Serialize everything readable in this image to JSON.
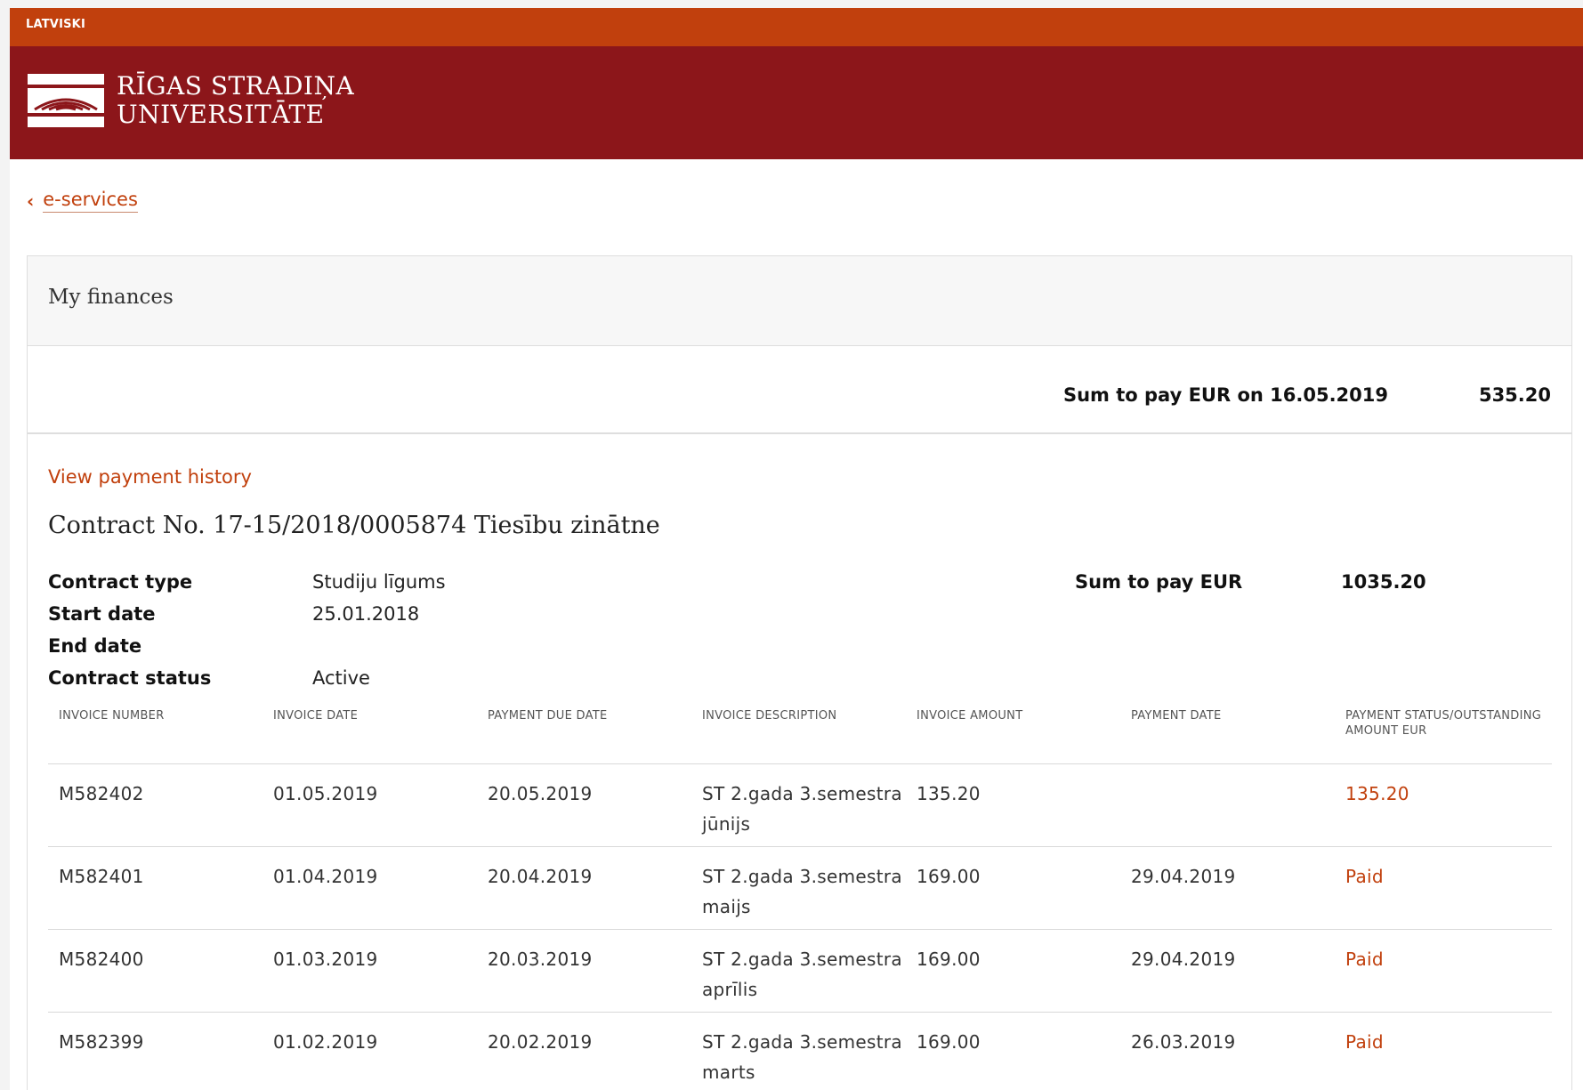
{
  "topbar": {
    "language_link": "LATVISKI"
  },
  "brand": {
    "line1": "RĪGAS STRADIŅA",
    "line2": "UNIVERSITĀTE",
    "accent_color": "#c1400d",
    "brand_color": "#8c161a"
  },
  "breadcrumb": {
    "back_label": "e-services"
  },
  "finances": {
    "title": "My finances",
    "sum_label": "Sum to pay EUR on 16.05.2019",
    "sum_value": "535.20",
    "history_link": "View payment history"
  },
  "contract": {
    "title": "Contract No. 17-15/2018/0005874 Tiesību zinātne",
    "fields": [
      {
        "label": "Contract type",
        "value": "Studiju līgums"
      },
      {
        "label": "Start date",
        "value": "25.01.2018"
      },
      {
        "label": "End date",
        "value": ""
      },
      {
        "label": "Contract status",
        "value": "Active"
      }
    ],
    "sum_label": "Sum to pay EUR",
    "sum_value": "1035.20"
  },
  "invoices": {
    "headers": [
      "INVOICE NUMBER",
      "INVOICE DATE",
      "PAYMENT DUE DATE",
      "INVOICE DESCRIPTION",
      "INVOICE AMOUNT",
      "PAYMENT DATE",
      "PAYMENT STATUS/OUTSTANDING AMOUNT EUR"
    ],
    "rows": [
      [
        "M582402",
        "01.05.2019",
        "20.05.2019",
        "ST 2.gada 3.semestra jūnijs",
        "135.20",
        "",
        "135.20"
      ],
      [
        "M582401",
        "01.04.2019",
        "20.04.2019",
        "ST 2.gada 3.semestra maijs",
        "169.00",
        "29.04.2019",
        "Paid"
      ],
      [
        "M582400",
        "01.03.2019",
        "20.03.2019",
        "ST 2.gada 3.semestra aprīlis",
        "169.00",
        "29.04.2019",
        "Paid"
      ],
      [
        "M582399",
        "01.02.2019",
        "20.02.2019",
        "ST 2.gada 3.semestra marts",
        "169.00",
        "26.03.2019",
        "Paid"
      ]
    ]
  }
}
